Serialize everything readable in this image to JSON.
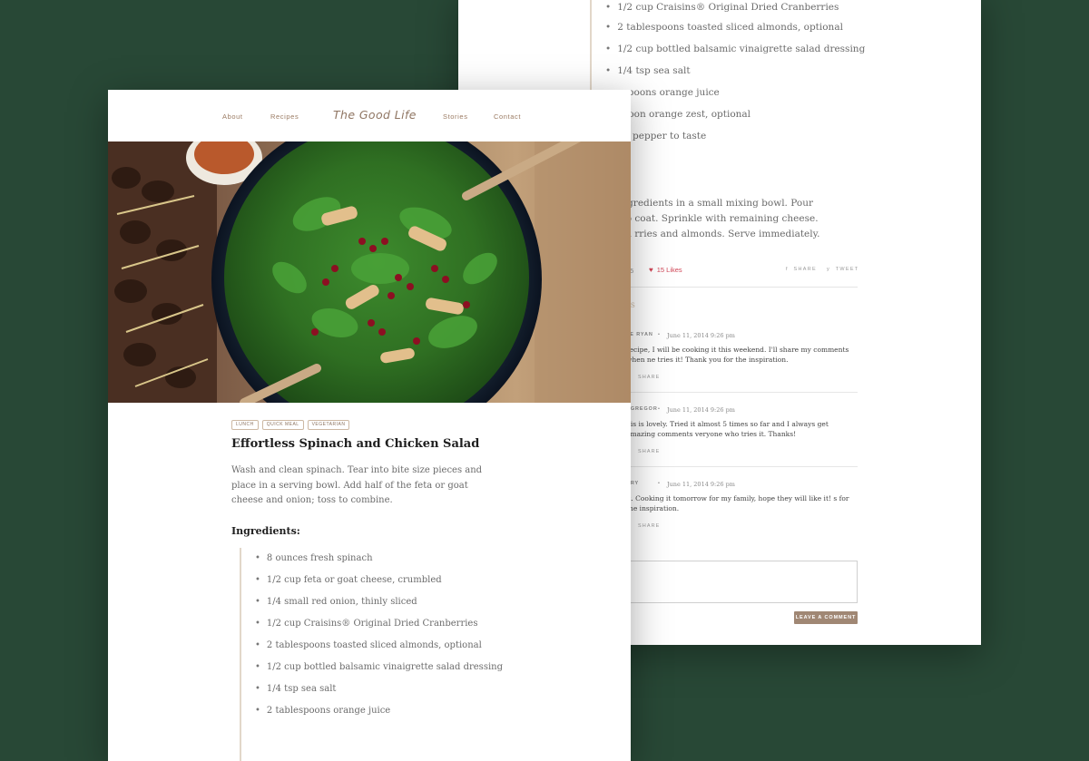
{
  "back_page": {
    "ingredients": [
      "1/2 cup Craisins® Original Dried Cranberries",
      "2 tablespoons toasted sliced almonds, optional",
      "1/2 cup bottled balsamic vinaigrette salad dressing",
      "1/4 tsp sea salt",
      "espoons orange juice",
      "spoon orange zest, optional",
      "nd pepper to taste"
    ],
    "directions_title": ":",
    "directions_text": "ssing ingredients in a small mixing bowl. Pour over s to coat. Sprinkle with remaining cheese. Top with rries and almonds. Serve immediately.",
    "meta": {
      "comments_count": "05",
      "likes": "15 Likes",
      "share": "SHARE",
      "tweet": "TWEET"
    },
    "comments_heading": "S",
    "comments": [
      {
        "author": "LE RYAN",
        "date": "June 11, 2014 9:26 pm",
        "text": "recipe, I will be cooking it this weekend. I'll share my comments when ne tries it! Thank you for the inspiration.",
        "share": "SHARE"
      },
      {
        "author": "CGREGOR",
        "date": "June 11, 2014 9:26 pm",
        "text": "his is lovely. Tried it almost 5 times so far and I always get amazing comments veryone who tries it. Thanks!",
        "share": "SHARE"
      },
      {
        "author": "RRY",
        "date": "June 11, 2014 9:26 pm",
        "text": "it. Cooking it tomorrow for my family, hope they will like it! s for the inspiration.",
        "share": "SHARE"
      }
    ],
    "leave_comment": "LEAVE A COMMENT"
  },
  "front_page": {
    "nav": {
      "about": "About",
      "recipes": "Recipes",
      "logo": "The Good Life",
      "stories": "Stories",
      "contact": "Contact"
    },
    "tags": [
      "LUNCH",
      "QUICK MEAL",
      "VEGETARIAN"
    ],
    "title": "Effortless Spinach and Chicken Salad",
    "intro": "Wash and clean spinach. Tear into bite size pieces and place in a serving bowl. Add half of the feta or goat cheese and onion; toss to combine.",
    "ingredients_title": "Ingredients:",
    "ingredients": [
      "8 ounces fresh spinach",
      "1/2 cup feta or goat cheese, crumbled",
      "1/4 small red onion, thinly sliced",
      "1/2 cup Craisins® Original Dried Cranberries",
      "2 tablespoons toasted sliced almonds, optional",
      "1/2 cup bottled balsamic vinaigrette salad dressing",
      "1/4 tsp sea salt",
      "2 tablespoons orange juice"
    ]
  },
  "colors": {
    "background": "#284836",
    "accent": "#9b7b63",
    "likes": "#d04556",
    "button": "#a08774"
  }
}
